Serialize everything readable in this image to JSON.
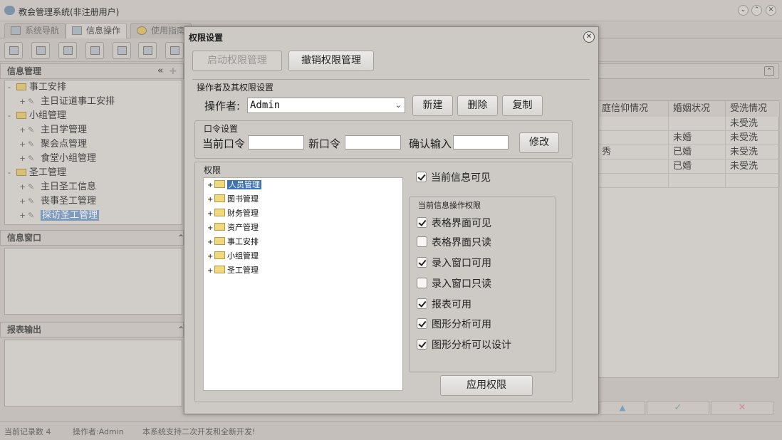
{
  "app": {
    "title": "教会管理系统(非注册用户)",
    "tabs": [
      {
        "label": "系统导航"
      },
      {
        "label": "信息操作"
      },
      {
        "label": "使用指南"
      }
    ]
  },
  "left_panel": {
    "info_header": "信息管理",
    "tree": [
      {
        "label": "事工安排",
        "type": "folder",
        "expanded": true
      },
      {
        "label": "主日证道事工安排",
        "type": "leaf"
      },
      {
        "label": "小组管理",
        "type": "folder",
        "expanded": true
      },
      {
        "label": "主日学管理",
        "type": "leaf"
      },
      {
        "label": "聚会点管理",
        "type": "leaf"
      },
      {
        "label": "食堂小组管理",
        "type": "leaf"
      },
      {
        "label": "圣工管理",
        "type": "folder",
        "expanded": true
      },
      {
        "label": "主日圣工信息",
        "type": "leaf"
      },
      {
        "label": "丧事圣工管理",
        "type": "leaf"
      },
      {
        "label": "探访圣工管理",
        "type": "leaf",
        "selected": true
      }
    ],
    "window_header": "信息窗口",
    "report_header": "报表输出"
  },
  "grid": {
    "headers": [
      "庭信仰情况",
      "婚姻状况",
      "受洗情况"
    ],
    "rows": [
      [
        "",
        "",
        "未受洗"
      ],
      [
        "",
        "未婚",
        "未受洗"
      ],
      [
        "秀",
        "已婚",
        "未受洗"
      ],
      [
        "",
        "已婚",
        "未受洗"
      ]
    ],
    "footer_icons": [
      "up-icon",
      "check-icon",
      "cross-icon"
    ]
  },
  "status": {
    "records": "当前记录数 4",
    "operator": "操作者:Admin",
    "message": "本系统支持二次开发和全新开发!"
  },
  "dialog": {
    "title": "权限设置",
    "enable_label": "启动权限管理",
    "revoke_label": "撤销权限管理",
    "operator_section": "操作者及其权限设置",
    "operator_label": "操作者:",
    "operator_value": "Admin",
    "new_label": "新建",
    "delete_label": "删除",
    "copy_label": "复制",
    "password_group": "口令设置",
    "current_pw_label": "当前口令",
    "new_pw_label": "新口令",
    "confirm_pw_label": "确认输入",
    "modify_label": "修改",
    "permissions_group": "权限",
    "perm_tree": [
      {
        "label": "人员管理",
        "selected": true
      },
      {
        "label": "图书管理"
      },
      {
        "label": "财务管理"
      },
      {
        "label": "资产管理"
      },
      {
        "label": "事工安排"
      },
      {
        "label": "小组管理"
      },
      {
        "label": "圣工管理"
      }
    ],
    "current_visible_label": "当前信息可见",
    "current_visible_checked": true,
    "ops_group": "当前信息操作权限",
    "ops": [
      {
        "label": "表格界面可见",
        "checked": true
      },
      {
        "label": "表格界面只读",
        "checked": false
      },
      {
        "label": "录入窗口可用",
        "checked": true
      },
      {
        "label": "录入窗口只读",
        "checked": false
      },
      {
        "label": "报表可用",
        "checked": true
      },
      {
        "label": "图形分析可用",
        "checked": true
      },
      {
        "label": "图形分析可以设计",
        "checked": true
      }
    ],
    "apply_label": "应用权限"
  }
}
